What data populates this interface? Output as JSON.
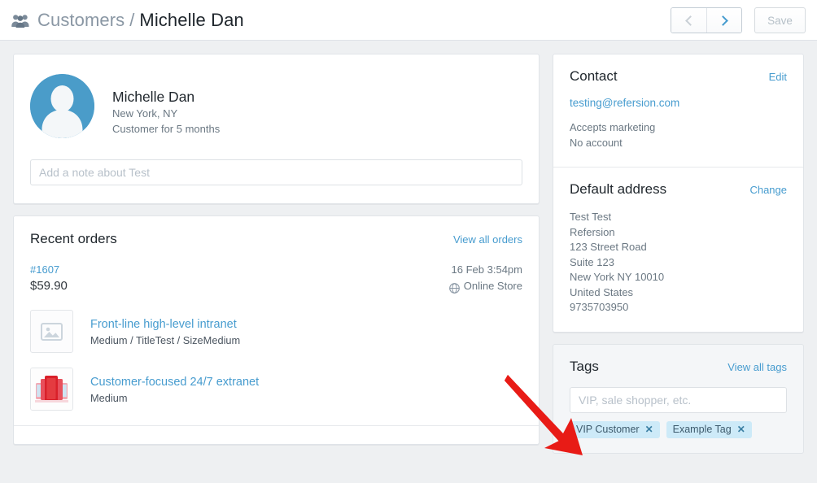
{
  "header": {
    "breadcrumb_icon": "people-group-icon",
    "breadcrumb_parent": "Customers",
    "breadcrumb_separator": "/",
    "breadcrumb_current": "Michelle Dan",
    "prev_icon": "chevron-left-icon",
    "next_icon": "chevron-right-icon",
    "save_label": "Save"
  },
  "profile": {
    "avatar_icon": "user-avatar-icon",
    "name": "Michelle Dan",
    "location": "New York, NY",
    "tenure": "Customer for 5 months",
    "note_placeholder": "Add a note about Test",
    "note_value": ""
  },
  "recent_orders": {
    "title": "Recent orders",
    "view_all_label": "View all orders",
    "order": {
      "number": "#1607",
      "total": "$59.90",
      "date": "16 Feb 3:54pm",
      "channel": "Online Store",
      "channel_icon": "globe-icon"
    },
    "line_items": [
      {
        "thumb_icon": "image-placeholder-icon",
        "title": "Front-line high-level intranet",
        "variant": "Medium / TitleTest / SizeMedium"
      },
      {
        "thumb_icon": "product-photo-icon",
        "title": "Customer-focused 24/7 extranet",
        "variant": "Medium"
      }
    ]
  },
  "contact": {
    "title": "Contact",
    "edit_label": "Edit",
    "email": "testing@refersion.com",
    "marketing_status": "Accepts marketing",
    "account_status": "No account"
  },
  "default_address": {
    "title": "Default address",
    "change_label": "Change",
    "lines": [
      "Test Test",
      "Refersion",
      "123 Street Road",
      "Suite 123",
      "New York NY 10010",
      "United States",
      "9735703950"
    ]
  },
  "tags": {
    "title": "Tags",
    "view_all_label": "View all tags",
    "input_placeholder": "VIP, sale shopper, etc.",
    "input_value": "",
    "items": [
      {
        "label": "VIP Customer",
        "remove_icon": "close-icon"
      },
      {
        "label": "Example Tag",
        "remove_icon": "close-icon"
      }
    ]
  },
  "annotation": {
    "arrow_color": "#e81b16",
    "arrow_target": "tag-pill-vip-customer"
  },
  "colors": {
    "page_background": "#eef0f2",
    "card_background": "#ffffff",
    "link_blue": "#479ccf",
    "avatar_blue": "#4a9cc9",
    "tag_pill_blue": "#cdeaf8",
    "text_primary": "#1f262c",
    "text_muted": "#6b7883",
    "border": "#e0e4e8",
    "annotation_red": "#e81b16"
  }
}
